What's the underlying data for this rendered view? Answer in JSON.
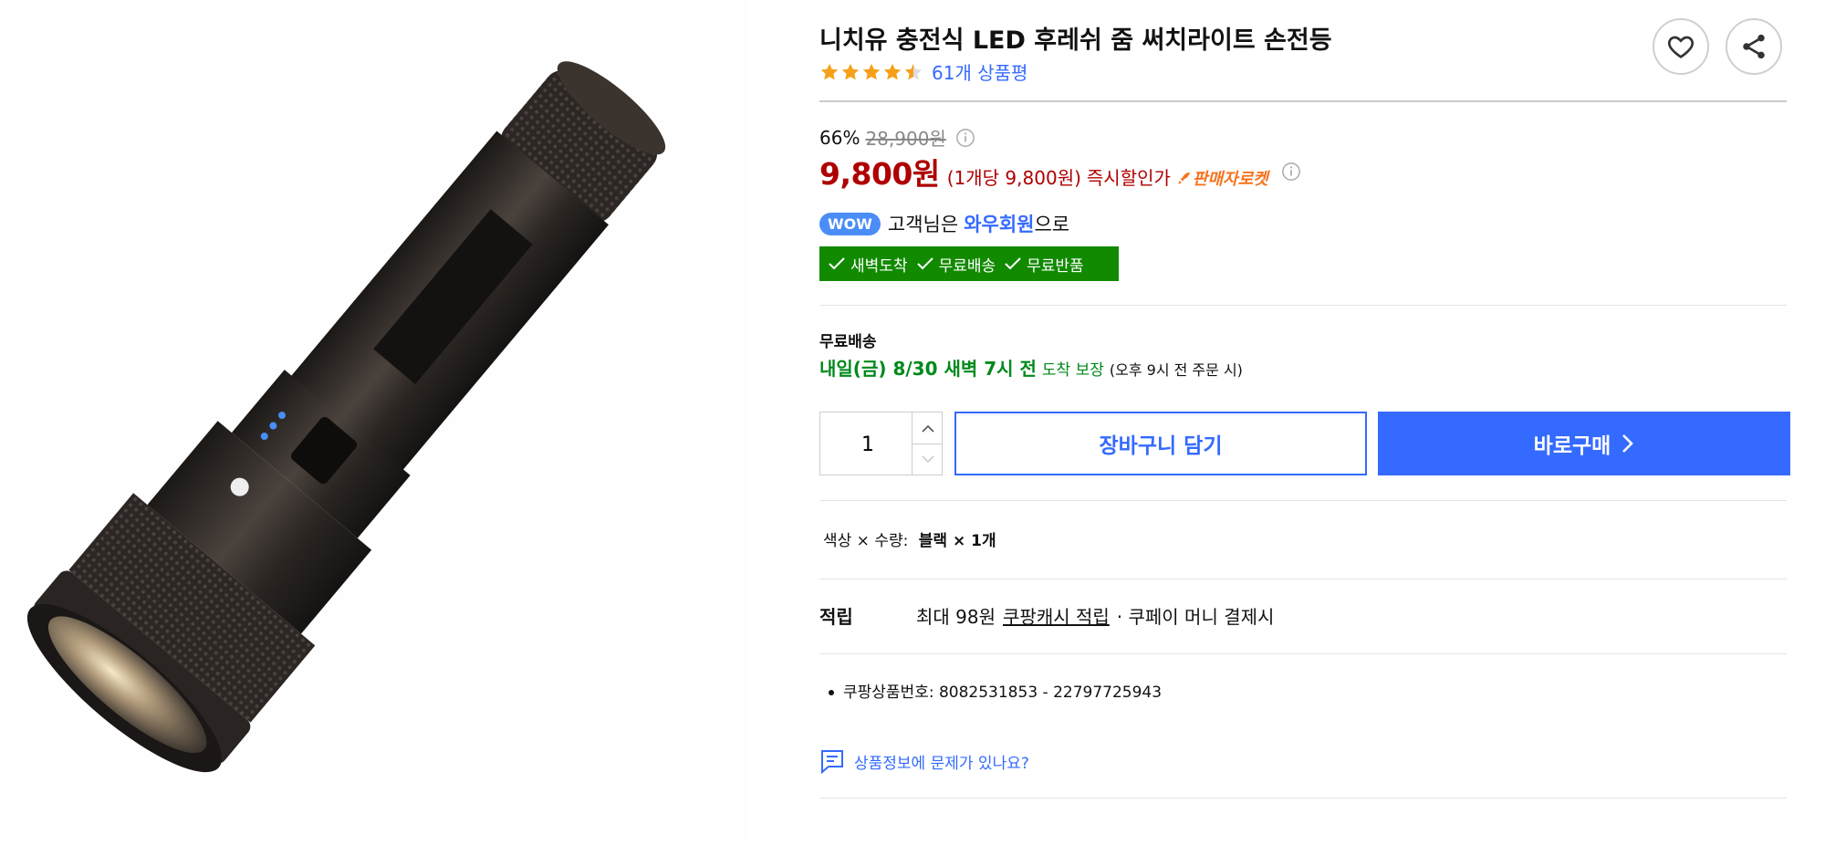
{
  "product": {
    "title": "니치유 충전식 LED 후레쉬 줌 써치라이트 손전등",
    "rating": 4.5,
    "review_count": "61개 상품평"
  },
  "price": {
    "discount_rate": "66%",
    "original_price": "28,900원",
    "sale_price": "9,800원",
    "unit_price": "(1개당 9,800원)",
    "instant_discount": "즉시할인가",
    "rocket_label": "판매자로켓"
  },
  "wow": {
    "badge": "WOW",
    "text_before": "고객님은",
    "member": "와우회원",
    "text_after": "으로"
  },
  "benefits": [
    "새벽도착",
    "무료배송",
    "무료반품"
  ],
  "shipping": {
    "title": "무료배송",
    "date": "내일(금) 8/30 새벽 7시 전",
    "guarantee": "도착 보장",
    "condition": "(오후 9시 전 주문 시)"
  },
  "quantity": "1",
  "buttons": {
    "cart": "장바구니 담기",
    "buy": "바로구매"
  },
  "option": {
    "label": "색상 × 수량:",
    "value": "블랙 × 1개"
  },
  "reward": {
    "label": "적립",
    "text_before": "최대 98원",
    "link": "쿠팡캐시 적립",
    "text_after": "· 쿠페이 머니 결제시"
  },
  "product_number": "쿠팡상품번호: 8082531853 - 22797725943",
  "report_link": "상품정보에 문제가 있나요?",
  "colors": {
    "accent_blue": "#346aff",
    "price_red": "#ae0000",
    "rocket_orange": "#f6731b",
    "green": "#118a00",
    "star": "#f6a01a"
  },
  "icons": [
    "heart-icon",
    "share-icon",
    "info-icon",
    "rocket-icon",
    "check-icon",
    "chevron-up-icon",
    "chevron-down-icon",
    "chevron-right-icon",
    "chat-icon"
  ]
}
